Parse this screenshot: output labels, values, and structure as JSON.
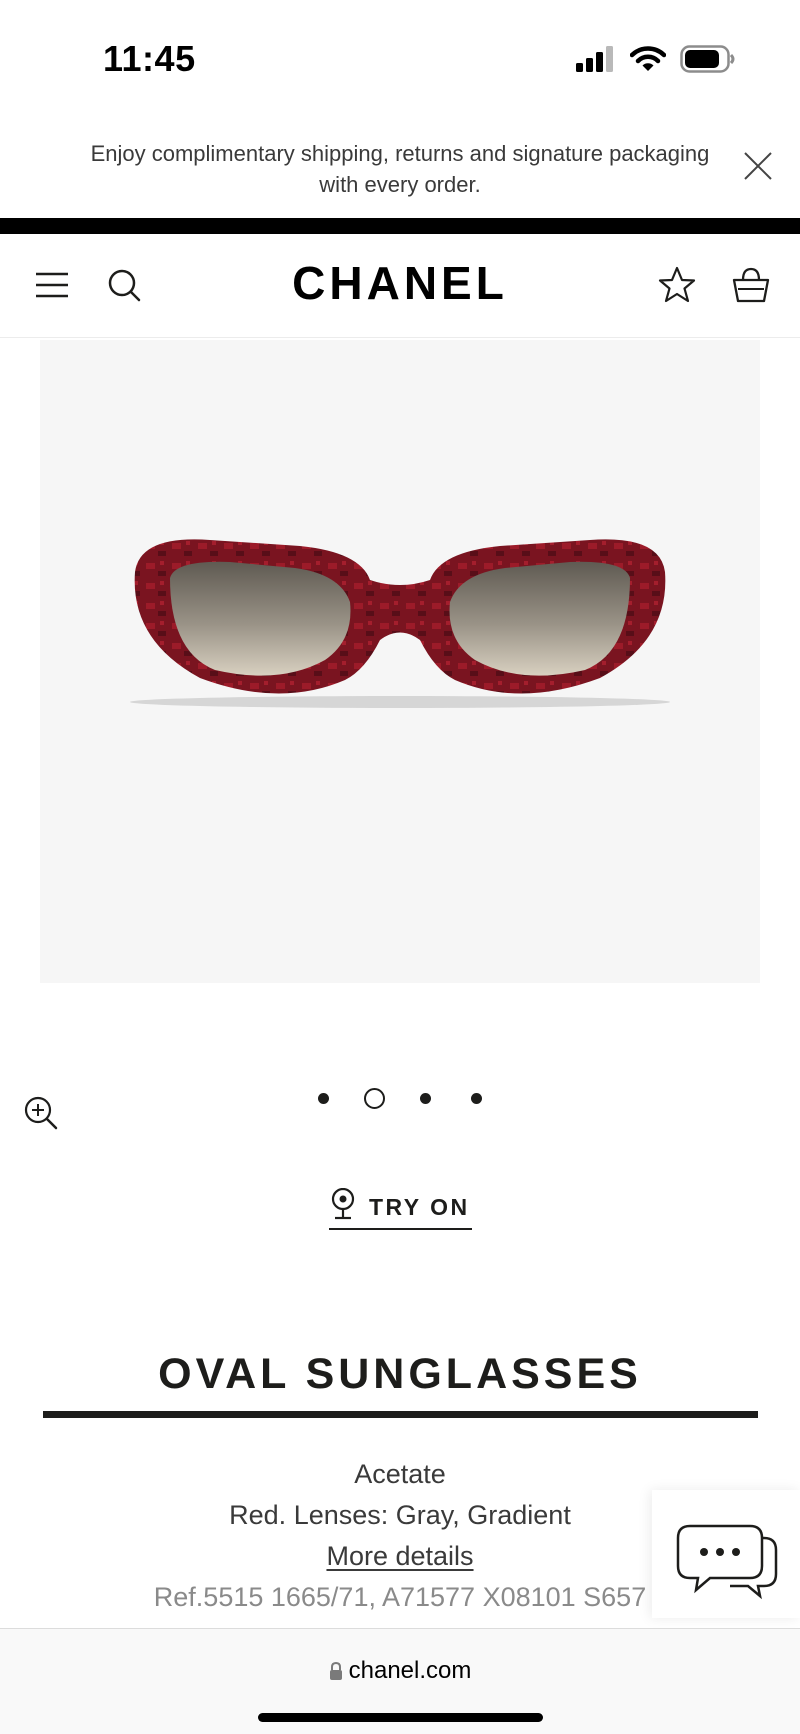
{
  "status_bar": {
    "time": "11:45",
    "icons": [
      "cellular-signal-icon",
      "wifi-icon",
      "battery-icon"
    ]
  },
  "promo": {
    "text_line1": "Enjoy complimentary shipping, returns and signature packaging",
    "text_line2": "with every order."
  },
  "header": {
    "brand": "CHANEL",
    "icons": [
      "menu-icon",
      "search-icon",
      "wishlist-star-icon",
      "shopping-bag-icon"
    ]
  },
  "gallery": {
    "slide_count": 4,
    "active_slide": 2,
    "image_subject": "red tortoise acetate oval sunglasses with gray gradient lenses"
  },
  "try_on": {
    "label": "TRY ON"
  },
  "product": {
    "title": "OVAL SUNGLASSES",
    "material": "Acetate",
    "color_lenses": "Red. Lenses: Gray, Gradient",
    "more_details": "More details",
    "reference": "Ref.5515 1665/71, A71577 X08101 S657"
  },
  "browser": {
    "url": "chanel.com"
  },
  "colors": {
    "text_primary": "#1d1d1b",
    "text_secondary": "#3a3a3a",
    "text_muted": "#8a8a8a",
    "image_background": "#f6f6f6",
    "frame_red": "#7a1420"
  }
}
